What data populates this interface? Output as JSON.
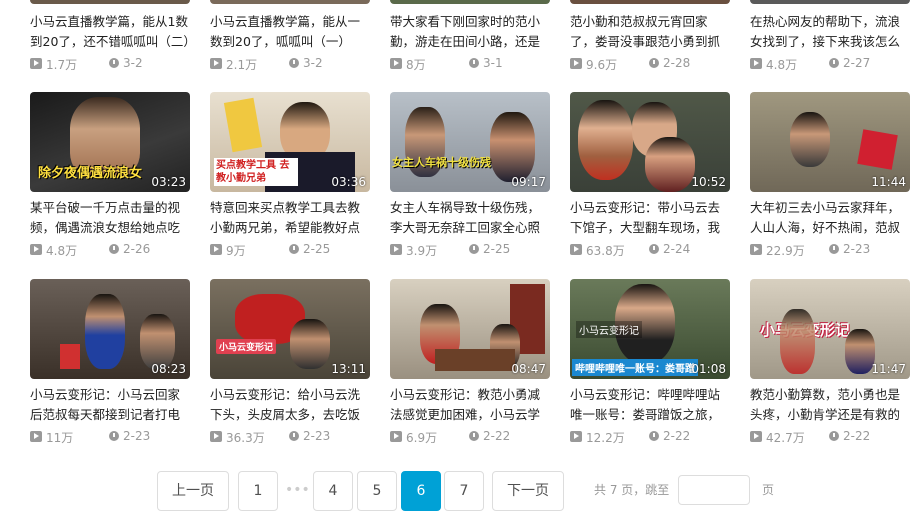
{
  "rows": [
    [
      {
        "title": "小马云直播教学篇，能从1数到20了，还不错呱呱叫（二）",
        "views": "1.7万",
        "date": "3-2"
      },
      {
        "title": "小马云直播教学篇，能从一数到20了，呱呱叫（一）",
        "views": "2.1万",
        "date": "3-2"
      },
      {
        "title": "带大家看下刚回家时的范小勤，游走在田间小路，还是那",
        "views": "8万",
        "date": "3-1"
      },
      {
        "title": "范小勤和范叔叔元宵回家了，娄哥没事跟范小勇到抓好多土",
        "views": "9.6万",
        "date": "2-28"
      },
      {
        "title": "在热心网友的帮助下，流浪女找到了，接下来我该怎么安排",
        "views": "4.8万",
        "date": "2-27"
      }
    ],
    [
      {
        "title": "某平台破一千万点击量的视频，偶遇流浪女想给她点吃的",
        "views": "4.8万",
        "date": "2-26",
        "duration": "03:23",
        "overlay": "除夕夜偶遇流浪女"
      },
      {
        "title": "特意回来买点教学工具去教小勤两兄弟，希望能教好点了不",
        "views": "9万",
        "date": "2-25",
        "duration": "03:36",
        "overlay": "买点教学工具 去教小勤兄弟"
      },
      {
        "title": "女主人车祸导致十级伤残，李大哥无奈辞工回家全心照顾妻",
        "views": "3.9万",
        "date": "2-25",
        "duration": "09:17",
        "overlay": "女主人车祸十级伤残"
      },
      {
        "title": "小马云变形记：带小马云去下馆子，大型翻车现场，我太难",
        "views": "63.8万",
        "date": "2-24",
        "duration": "10:52",
        "overlay": ""
      },
      {
        "title": "大年初三去小马云家拜年，人山人海，好不热闹，范叔叔盛",
        "views": "22.9万",
        "date": "2-23",
        "duration": "11:44",
        "overlay": ""
      }
    ],
    [
      {
        "title": "小马云变形记：小马云回家后范叔每天都接到记者打电话采",
        "views": "11万",
        "date": "2-23",
        "duration": "08:23",
        "overlay": ""
      },
      {
        "title": "小马云变形记：给小马云洗下头，头皮屑太多，去吃饭店，",
        "views": "36.3万",
        "date": "2-23",
        "duration": "13:11",
        "overlay": "小马云变形记"
      },
      {
        "title": "小马云变形记：教范小勇减法感觉更加困难，小马云学的不",
        "views": "6.9万",
        "date": "2-22",
        "duration": "08:47",
        "overlay": ""
      },
      {
        "title": "小马云变形记：哔哩哔哩站唯一账号：娄哥蹭饭之旅，谢谢",
        "views": "12.2万",
        "date": "2-22",
        "duration": "01:08",
        "overlay": "哔哩哔哩唯一账号：娄哥蹭"
      },
      {
        "title": "教范小勤算数，范小勇也是头疼，小勤肯学还是有救的",
        "views": "42.7万",
        "date": "2-22",
        "duration": "11:47",
        "overlay": "小马云变形记"
      }
    ]
  ],
  "pager": {
    "prev": "上一页",
    "p1": "1",
    "dots": "•••",
    "p4": "4",
    "p5": "5",
    "p6": "6",
    "p7": "7",
    "next": "下一页",
    "total": "共 7 页，跳至",
    "unit": "页"
  },
  "colors": {
    "accent": "#00a1d6"
  }
}
